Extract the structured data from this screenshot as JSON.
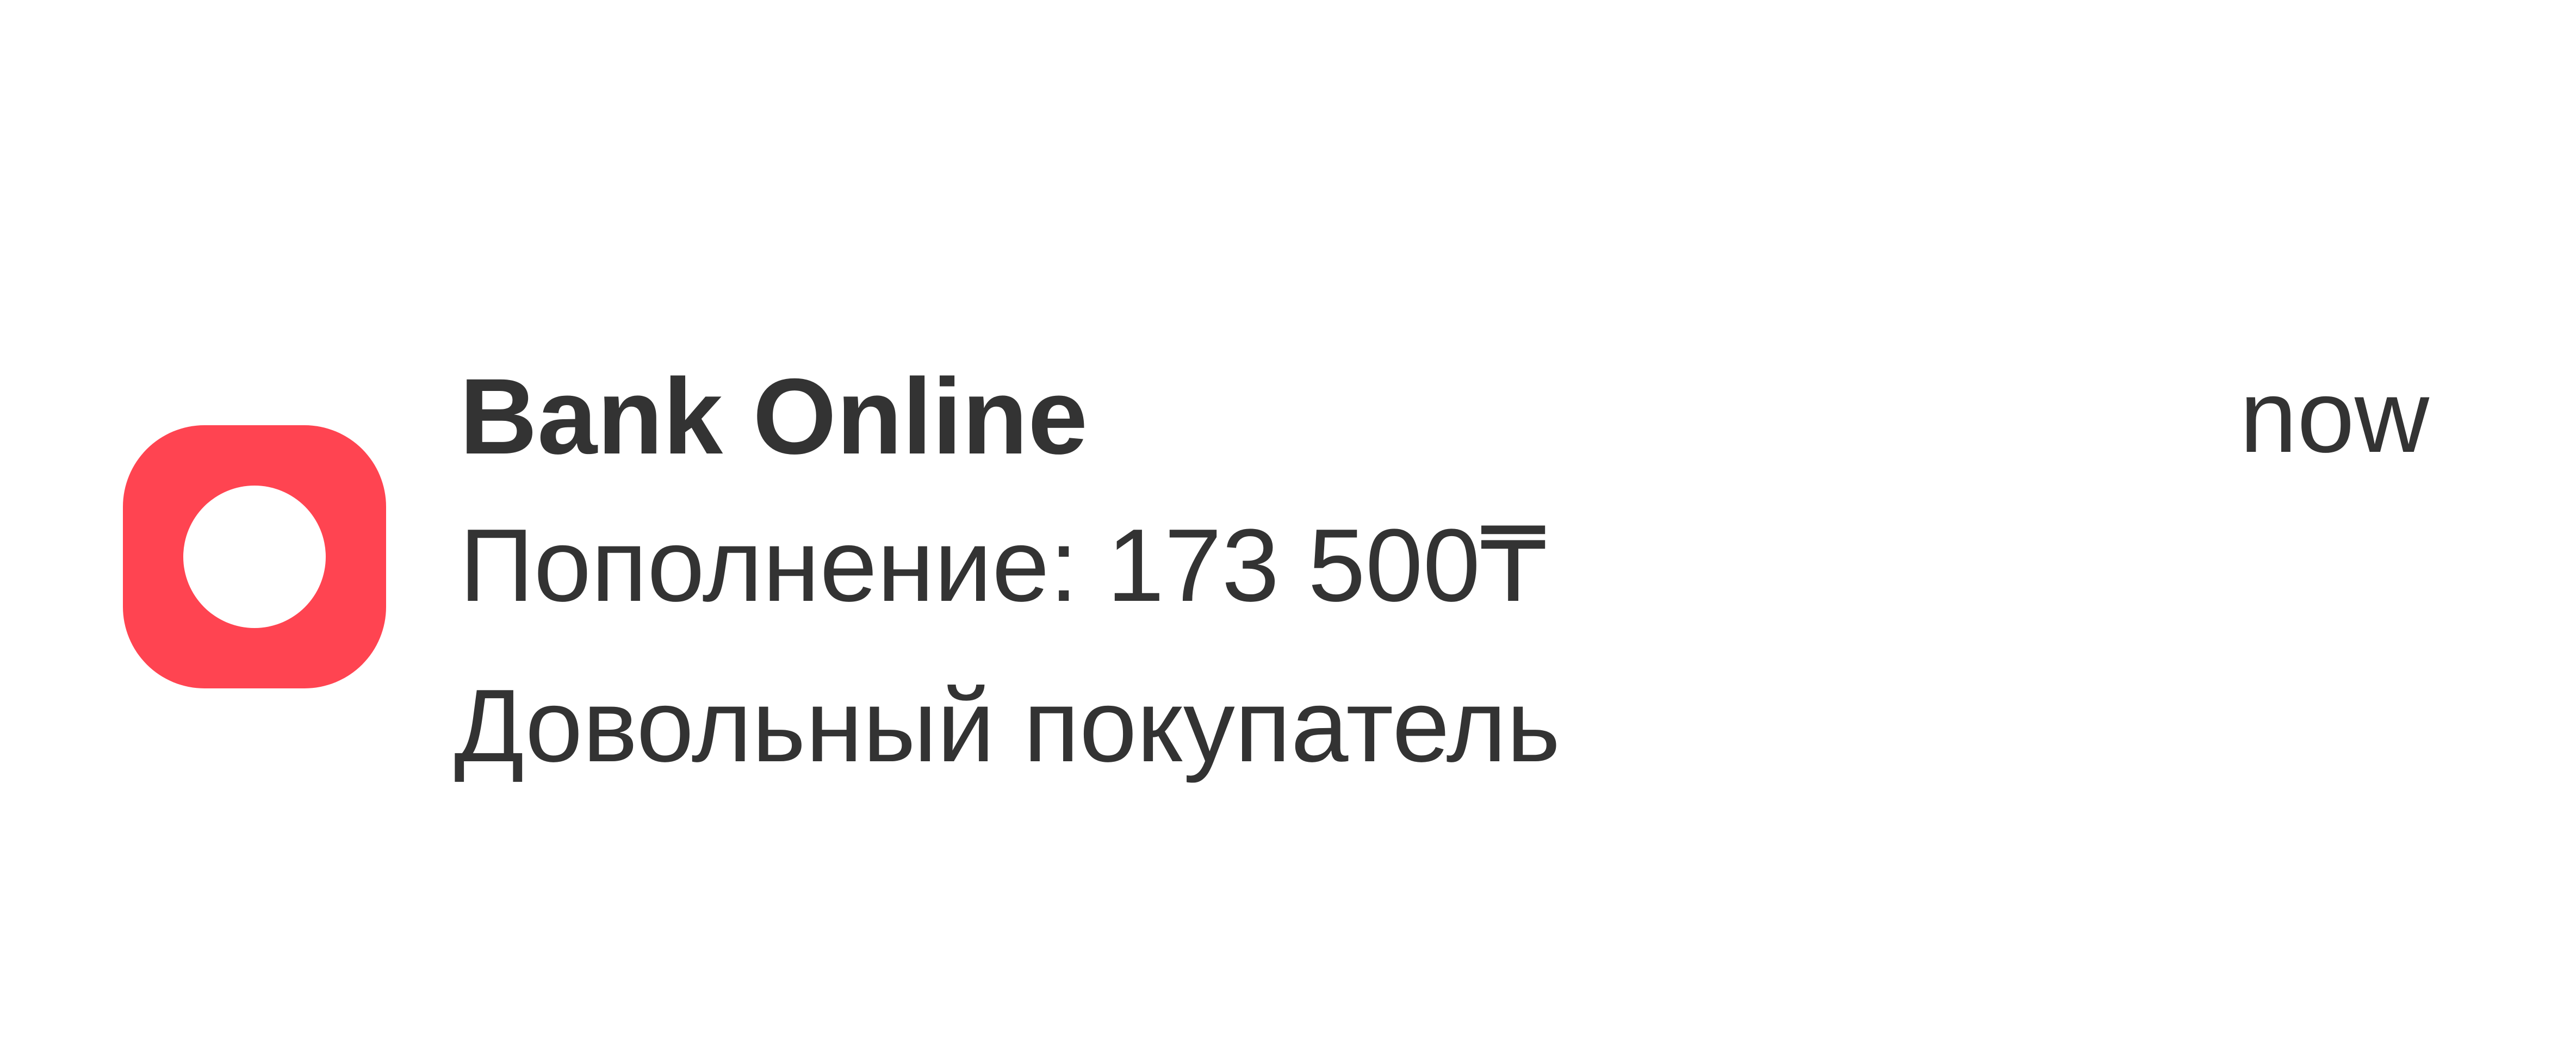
{
  "notification": {
    "app_name": "Bank Online",
    "time": "now",
    "title": "Пополнение: 173 500₸",
    "body": "Довольный покупатель",
    "app_icon": {
      "name": "bank-online-app-icon",
      "color": "#FF4451",
      "inner_color": "#FFFFFF"
    }
  }
}
